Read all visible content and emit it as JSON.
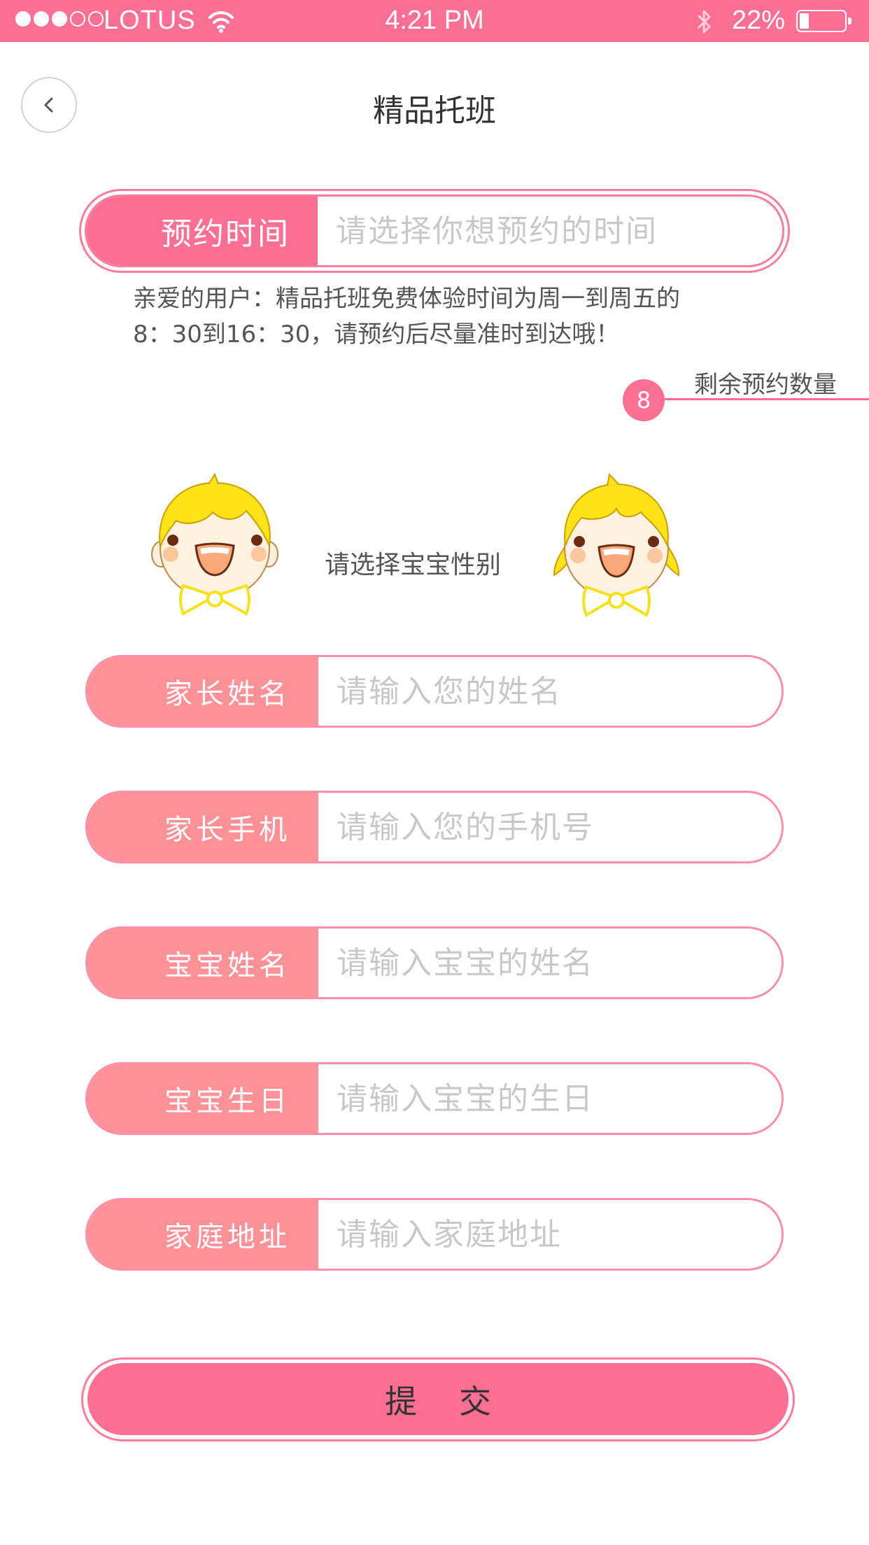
{
  "status_bar": {
    "carrier": "LOTUS",
    "time": "4:21 PM",
    "battery": "22%",
    "battery_level": 0.22,
    "signal_bars": 3,
    "signal_max": 5
  },
  "header": {
    "title": "精品托班"
  },
  "booking": {
    "label": "预约时间",
    "placeholder": "请选择你想预约的时间"
  },
  "notice": {
    "line1": "亲爱的用户：精品托班免费体验时间为周一到周五的",
    "line2": "8：30到16：30，请预约后尽量准时到达哦！"
  },
  "remaining": {
    "count": "8",
    "label": "剩余预约数量"
  },
  "gender": {
    "prompt": "请选择宝宝性别"
  },
  "fields": [
    {
      "label": "家长姓名",
      "placeholder": "请输入您的姓名"
    },
    {
      "label": "家长手机",
      "placeholder": "请输入您的手机号"
    },
    {
      "label": "宝宝姓名",
      "placeholder": "请输入宝宝的姓名"
    },
    {
      "label": "宝宝生日",
      "placeholder": "请输入宝宝的生日"
    },
    {
      "label": "家庭地址",
      "placeholder": "请输入家庭地址"
    }
  ],
  "submit": {
    "label": "提交"
  },
  "colors": {
    "accent": "#fc6f95",
    "label_bg": "#fd9198",
    "border": "#fc8ea7"
  }
}
